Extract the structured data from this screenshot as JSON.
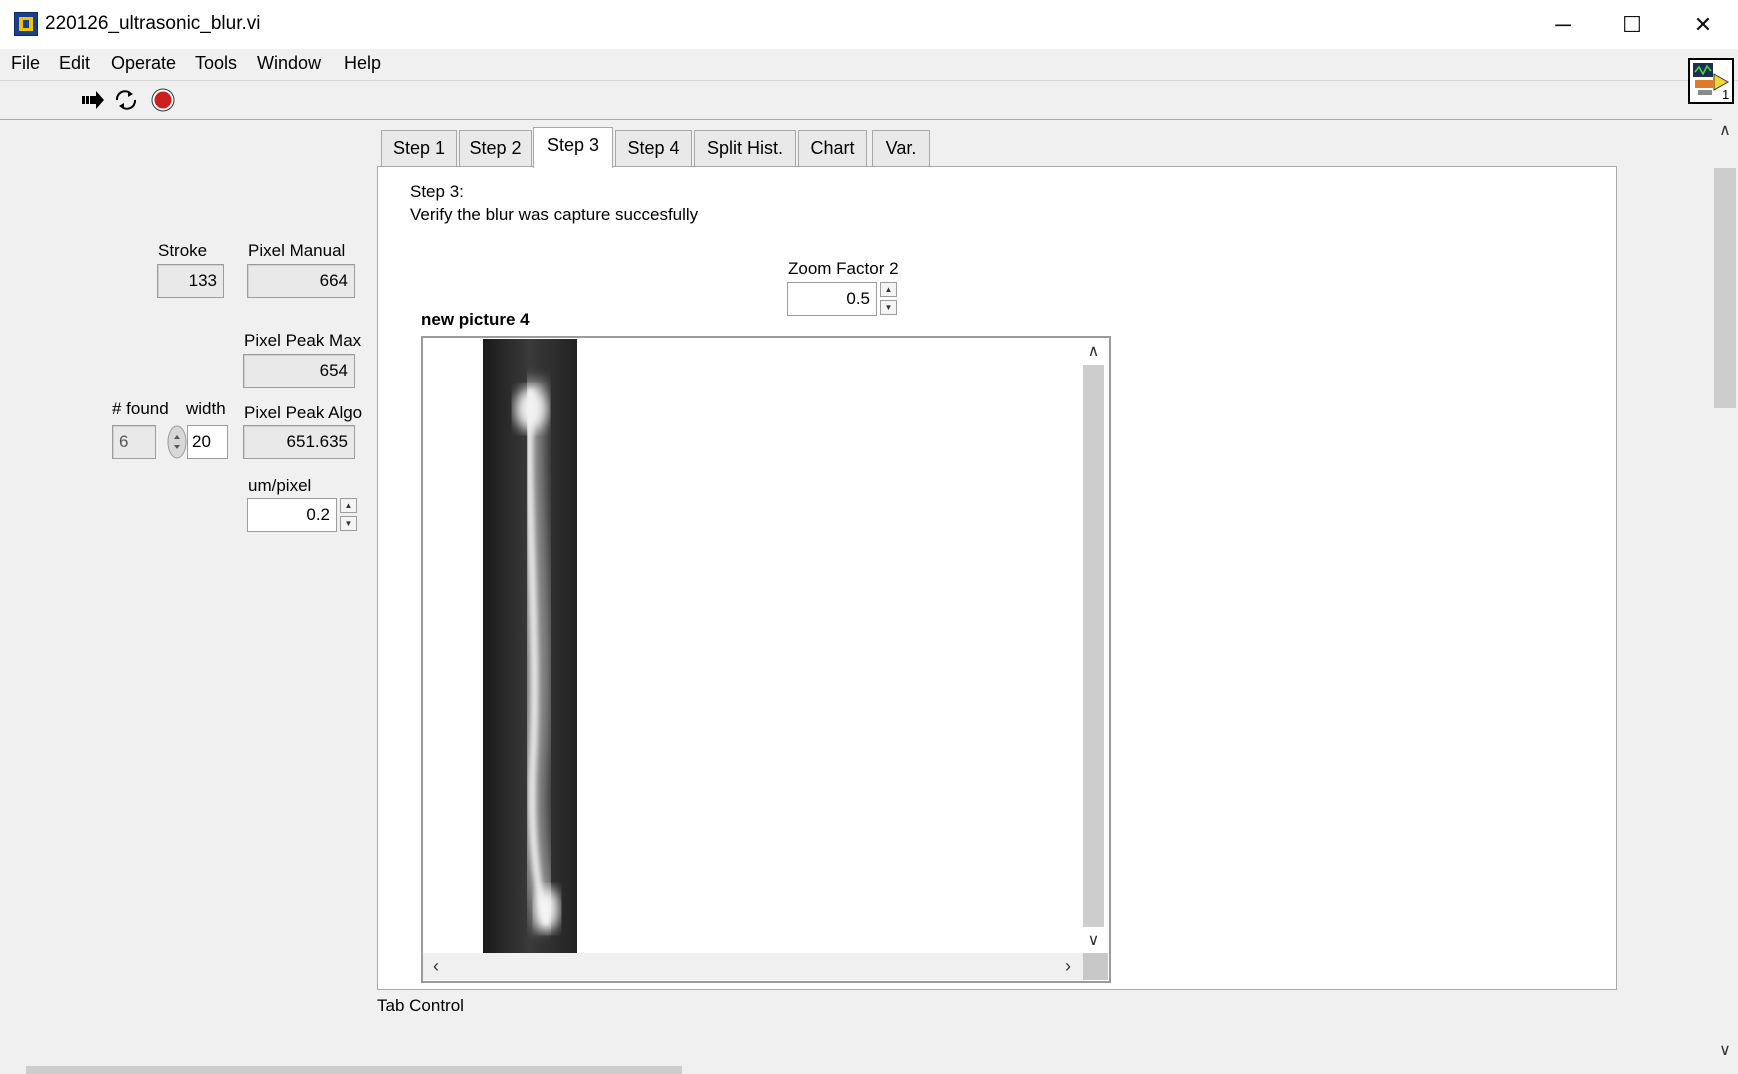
{
  "window": {
    "title": "220126_ultrasonic_blur.vi",
    "minimize_glyph": "─",
    "maximize_glyph": "☐",
    "close_glyph": "✕"
  },
  "menu": [
    "File",
    "Edit",
    "Operate",
    "Tools",
    "Window",
    "Help"
  ],
  "toolbar": {
    "icons": [
      "run-arrow-icon",
      "run-continuously-icon",
      "abort-stop-icon"
    ]
  },
  "vi_icon": {
    "badge": "1"
  },
  "indicators": {
    "stroke": {
      "label": "Stroke",
      "value": "133"
    },
    "pixel_manual": {
      "label": "Pixel Manual",
      "value": "664"
    },
    "pixel_peak_max": {
      "label": "Pixel Peak Max",
      "value": "654"
    },
    "found": {
      "label": "# found",
      "value": "6"
    },
    "width": {
      "label": "width",
      "value": "20"
    },
    "pixel_peak_algo": {
      "label": "Pixel Peak Algo",
      "value": "651.635"
    },
    "um_per_pixel": {
      "label": "um/pixel",
      "value": "0.2"
    }
  },
  "tabs": [
    "Step 1",
    "Step 2",
    "Step 3",
    "Step 4",
    "Split Hist.",
    "Chart",
    "Var."
  ],
  "active_tab": "Step 3",
  "step3": {
    "heading": "Step 3:",
    "instruction": "Verify the blur was capture succesfully",
    "zoom": {
      "label": "Zoom Factor 2",
      "value": "0.5"
    },
    "picture_label": "new picture 4"
  },
  "tab_control_label": "Tab Control",
  "colors": {
    "panel_bg": "#f0f0f0",
    "stop_button": "#cc1f1f"
  }
}
